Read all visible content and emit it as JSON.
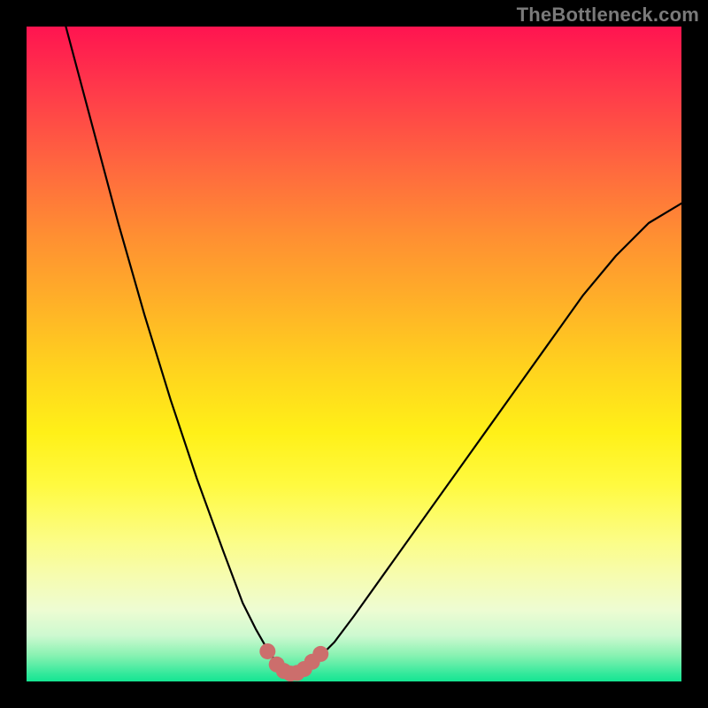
{
  "watermark": "TheBottleneck.com",
  "colors": {
    "background": "#000000",
    "curve_stroke": "#000000",
    "marker_fill": "#cc6e6c",
    "gradient_top": "#ff1450",
    "gradient_bottom": "#14e592"
  },
  "chart_data": {
    "type": "line",
    "title": "",
    "xlabel": "",
    "ylabel": "",
    "xlim": [
      0,
      100
    ],
    "ylim": [
      0,
      100
    ],
    "grid": false,
    "series": [
      {
        "name": "bottleneck-curve",
        "x": [
          6,
          10,
          14,
          18,
          22,
          26,
          30,
          33,
          35,
          37,
          38.5,
          40,
          41.5,
          43,
          44.5,
          47,
          50,
          55,
          60,
          65,
          70,
          75,
          80,
          85,
          90,
          95,
          100
        ],
        "y": [
          100,
          85,
          70,
          56,
          43,
          31,
          20,
          12,
          8,
          4.5,
          2.5,
          1.5,
          1.5,
          2,
          3.5,
          6,
          10,
          17,
          24,
          31,
          38,
          45,
          52,
          59,
          65,
          70,
          73
        ]
      }
    ],
    "markers": {
      "name": "flat-region-markers",
      "x": [
        36.8,
        38.2,
        39.3,
        40.3,
        41.3,
        42.4,
        43.6,
        44.9
      ],
      "y": [
        4.6,
        2.6,
        1.6,
        1.2,
        1.3,
        1.9,
        3.0,
        4.2
      ]
    }
  }
}
